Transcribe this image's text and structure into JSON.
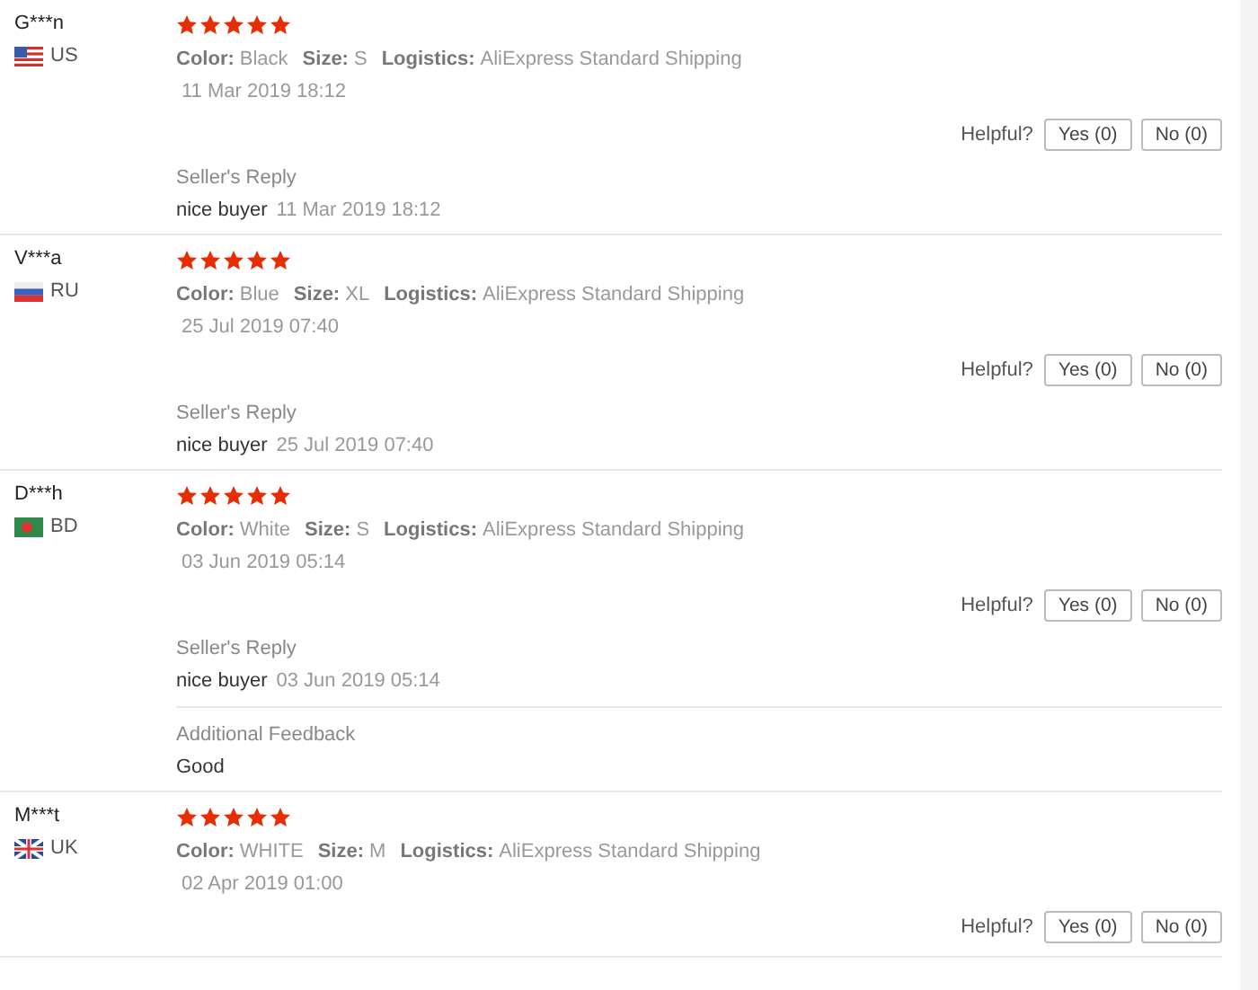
{
  "reviews": [
    {
      "user": "G***n",
      "kind": "us",
      "country": "US",
      "stars": 5,
      "color_label": "Color:",
      "color_value": "Black",
      "size_label": "Size:",
      "size": "S",
      "logistics_label": "Logistics:",
      "logistics": "AliExpress Standard Shipping",
      "date": "11 Mar 2019 18:12",
      "helpful_label": "Helpful?",
      "yes_button": "Yes (0)",
      "no_button": "No (0)",
      "reply_title": "Seller's Reply",
      "reply_text": "nice buyer",
      "reply_date": "11 Mar 2019 18:12"
    },
    {
      "user": "V***a",
      "kind": "ru",
      "country": "RU",
      "stars": 5,
      "color_label": "Color:",
      "color_value": "Blue",
      "size_label": "Size:",
      "size": "XL",
      "logistics_label": "Logistics:",
      "logistics": "AliExpress Standard Shipping",
      "date": "25 Jul 2019 07:40",
      "helpful_label": "Helpful?",
      "yes_button": "Yes (0)",
      "no_button": "No (0)",
      "reply_title": "Seller's Reply",
      "reply_text": "nice buyer",
      "reply_date": "25 Jul 2019 07:40"
    },
    {
      "user": "D***h",
      "kind": "bd",
      "country": "BD",
      "stars": 5,
      "color_label": "Color:",
      "color_value": "White",
      "size_label": "Size:",
      "size": "S",
      "logistics_label": "Logistics:",
      "logistics": "AliExpress Standard Shipping",
      "date": "03 Jun 2019 05:14",
      "helpful_label": "Helpful?",
      "yes_button": "Yes (0)",
      "no_button": "No (0)",
      "reply_title": "Seller's Reply",
      "reply_text": "nice buyer",
      "reply_date": "03 Jun 2019 05:14",
      "additional_title": "Additional Feedback",
      "additional_text": "Good"
    },
    {
      "user": "M***t",
      "kind": "uk",
      "country": "UK",
      "stars": 5,
      "color_label": "Color:",
      "color_value": "WHITE",
      "size_label": "Size:",
      "size": "M",
      "logistics_label": "Logistics:",
      "logistics": "AliExpress Standard Shipping",
      "date": "02 Apr 2019 01:00",
      "helpful_label": "Helpful?",
      "yes_button": "Yes (0)",
      "no_button": "No (0)"
    }
  ]
}
